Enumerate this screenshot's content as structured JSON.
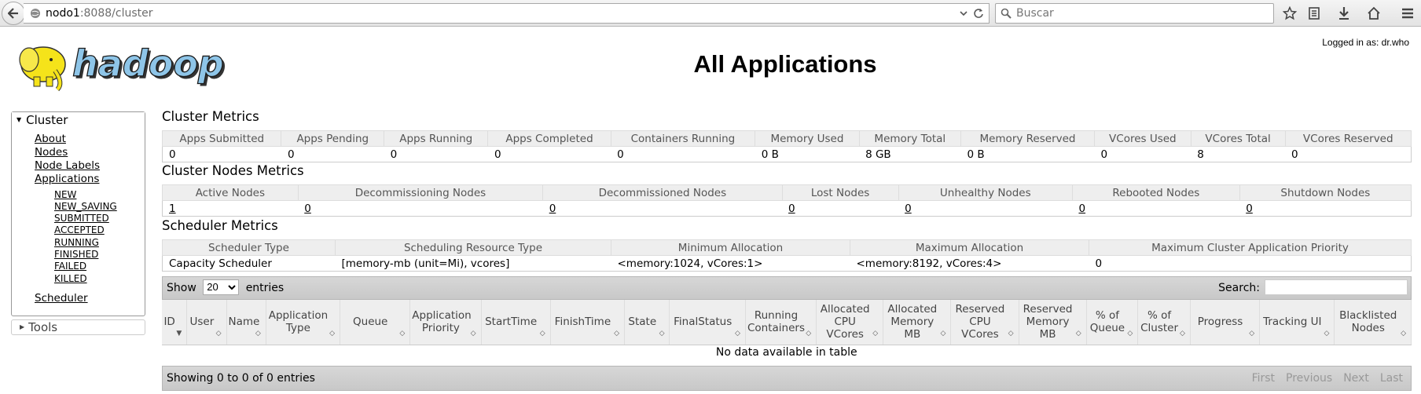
{
  "browser": {
    "url_host": "nodo1",
    "url_rest": ":8088/cluster",
    "search_placeholder": "Buscar"
  },
  "header": {
    "logged_in": "Logged in as: dr.who",
    "title": "All Applications",
    "logo_text": "hadoop"
  },
  "sidebar": {
    "cluster_label": "Cluster",
    "items": [
      "About",
      "Nodes",
      "Node Labels",
      "Applications"
    ],
    "app_states": [
      "NEW",
      "NEW_SAVING",
      "SUBMITTED",
      "ACCEPTED",
      "RUNNING",
      "FINISHED",
      "FAILED",
      "KILLED"
    ],
    "scheduler": "Scheduler",
    "tools_label": "Tools"
  },
  "cluster_metrics": {
    "title": "Cluster Metrics",
    "headers": [
      "Apps Submitted",
      "Apps Pending",
      "Apps Running",
      "Apps Completed",
      "Containers Running",
      "Memory Used",
      "Memory Total",
      "Memory Reserved",
      "VCores Used",
      "VCores Total",
      "VCores Reserved"
    ],
    "values": [
      "0",
      "0",
      "0",
      "0",
      "0",
      "0 B",
      "8 GB",
      "0 B",
      "0",
      "8",
      "0"
    ]
  },
  "node_metrics": {
    "title": "Cluster Nodes Metrics",
    "headers": [
      "Active Nodes",
      "Decommissioning Nodes",
      "Decommissioned Nodes",
      "Lost Nodes",
      "Unhealthy Nodes",
      "Rebooted Nodes",
      "Shutdown Nodes"
    ],
    "values": [
      "1",
      "0",
      "0",
      "0",
      "0",
      "0",
      "0"
    ]
  },
  "scheduler_metrics": {
    "title": "Scheduler Metrics",
    "headers": [
      "Scheduler Type",
      "Scheduling Resource Type",
      "Minimum Allocation",
      "Maximum Allocation",
      "Maximum Cluster Application Priority"
    ],
    "values": [
      "Capacity Scheduler",
      "[memory-mb (unit=Mi), vcores]",
      "<memory:1024, vCores:1>",
      "<memory:8192, vCores:4>",
      "0"
    ]
  },
  "apps": {
    "show_label": "Show",
    "entries_value": "20",
    "entries_label": "entries",
    "search_label": "Search:",
    "columns": [
      "ID",
      "User",
      "Name",
      "Application Type",
      "Queue",
      "Application Priority",
      "StartTime",
      "FinishTime",
      "State",
      "FinalStatus",
      "Running Containers",
      "Allocated CPU VCores",
      "Allocated Memory MB",
      "Reserved CPU VCores",
      "Reserved Memory MB",
      "% of Queue",
      "% of Cluster",
      "Progress",
      "Tracking UI",
      "Blacklisted Nodes"
    ],
    "empty_text": "No data available in table",
    "showing_text": "Showing 0 to 0 of 0 entries",
    "pager": [
      "First",
      "Previous",
      "Next",
      "Last"
    ]
  }
}
